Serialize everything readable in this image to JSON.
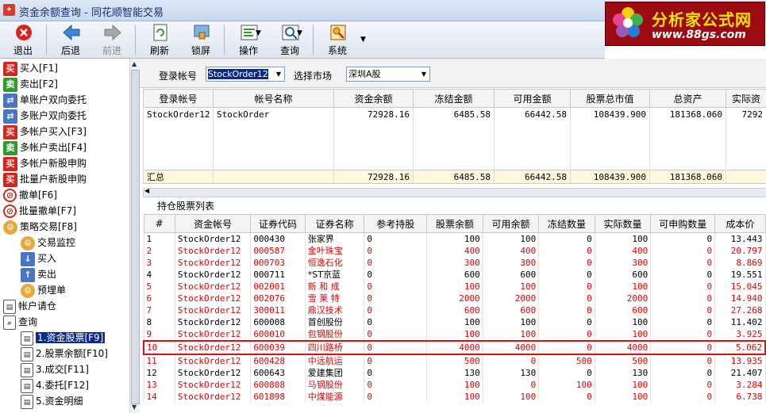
{
  "window": {
    "title": "资金余额查询 - 同花顺智能交易"
  },
  "logo": {
    "text": "分析家公式网",
    "url": "www.88gs.com"
  },
  "toolbar": {
    "exit": "退出",
    "back": "后退",
    "forward": "前进",
    "refresh": "刷新",
    "lock": "锁屏",
    "operate": "操作",
    "query": "查询",
    "system": "系统"
  },
  "sidebar": {
    "items": [
      {
        "label": "买入[F1]"
      },
      {
        "label": "卖出[F2]"
      },
      {
        "label": "单账户双向委托"
      },
      {
        "label": "多账户双向委托"
      },
      {
        "label": "多帐户买入[F3]"
      },
      {
        "label": "多帐户卖出[F4]"
      },
      {
        "label": "多帐户新股申购"
      },
      {
        "label": "批量户新股申购"
      },
      {
        "label": "撤单[F6]"
      },
      {
        "label": "批量撤单[F7]"
      },
      {
        "label": "策略交易[F8]"
      },
      {
        "label": "交易监控"
      },
      {
        "label": "买入"
      },
      {
        "label": "卖出"
      },
      {
        "label": "预埋单"
      },
      {
        "label": "帐户请仓"
      },
      {
        "label": "查询"
      },
      {
        "label": "1.资金股票[F9]"
      },
      {
        "label": "2.股票余额[F10]"
      },
      {
        "label": "3.成交[F11]"
      },
      {
        "label": "4.委托[F12]"
      },
      {
        "label": "5.资金明细"
      }
    ],
    "glyphs": {
      "buy": "买",
      "sell": "卖"
    }
  },
  "filter": {
    "account_label": "登录帐号",
    "account_value": "StockOrder12",
    "market_label": "选择市场",
    "market_value": "深圳A股"
  },
  "accounts": {
    "headers": [
      "登录帐号",
      "帐号名称",
      "资金余额",
      "冻结金额",
      "可用金额",
      "股票总市值",
      "总资产",
      "实际资"
    ],
    "row": [
      "StockOrder12",
      "StockOrder",
      "72928.16",
      "6485.58",
      "66442.58",
      "108439.900",
      "181368.060",
      "7292"
    ],
    "summary": [
      "汇总",
      "",
      "72928.16",
      "6485.58",
      "66442.58",
      "108439.900",
      "181368.060",
      ""
    ]
  },
  "positions": {
    "label": "持仓股票列表",
    "headers": [
      "#",
      "资金帐号",
      "证券代码",
      "证券名称",
      "参考持股",
      "股票余额",
      "可用余额",
      "冻结数量",
      "实际数量",
      "可申购数量",
      "成本价"
    ],
    "rows": [
      [
        "1",
        "StockOrder12",
        "000430",
        "张家界",
        "0",
        "100",
        "100",
        "0",
        "100",
        "0",
        "13.443"
      ],
      [
        "2",
        "StockOrder12",
        "000587",
        "金叶珠宝",
        "0",
        "400",
        "400",
        "0",
        "400",
        "0",
        "20.797"
      ],
      [
        "3",
        "StockOrder12",
        "000703",
        "恒逸石化",
        "0",
        "300",
        "300",
        "0",
        "300",
        "0",
        "8.869"
      ],
      [
        "4",
        "StockOrder12",
        "000711",
        "*ST京蓝",
        "0",
        "600",
        "600",
        "0",
        "600",
        "0",
        "19.551"
      ],
      [
        "5",
        "StockOrder12",
        "002001",
        "新 和 成",
        "0",
        "100",
        "100",
        "0",
        "100",
        "0",
        "15.045"
      ],
      [
        "6",
        "StockOrder12",
        "002076",
        "雪 莱 特",
        "0",
        "2000",
        "2000",
        "0",
        "2000",
        "0",
        "14.940"
      ],
      [
        "7",
        "StockOrder12",
        "300011",
        "鼎汉技术",
        "0",
        "600",
        "600",
        "0",
        "600",
        "0",
        "27.268"
      ],
      [
        "8",
        "StockOrder12",
        "600008",
        "首创股份",
        "0",
        "100",
        "100",
        "0",
        "100",
        "0",
        "11.402"
      ],
      [
        "9",
        "StockOrder12",
        "600010",
        "包钢股份",
        "0",
        "100",
        "100",
        "0",
        "100",
        "0",
        "3.925"
      ],
      [
        "10",
        "StockOrder12",
        "600039",
        "四川路桥",
        "0",
        "4000",
        "4000",
        "0",
        "4000",
        "0",
        "5.062"
      ],
      [
        "11",
        "StockOrder12",
        "600428",
        "中远航运",
        "0",
        "500",
        "0",
        "500",
        "500",
        "0",
        "13.935"
      ],
      [
        "12",
        "StockOrder12",
        "600643",
        "爱建集团",
        "0",
        "130",
        "130",
        "0",
        "130",
        "0",
        "21.407"
      ],
      [
        "13",
        "StockOrder12",
        "600808",
        "马钢股份",
        "0",
        "100",
        "0",
        "100",
        "100",
        "0",
        "3.284"
      ],
      [
        "14",
        "StockOrder12",
        "601898",
        "中煤能源",
        "0",
        "100",
        "100",
        "0",
        "100",
        "0",
        "6.738"
      ]
    ],
    "red_rows": [
      2,
      3,
      5,
      6,
      7,
      9,
      10,
      11,
      13,
      14
    ],
    "highlighted_row": 10,
    "colors": {
      "up": "#e60000",
      "down": "#000000",
      "highlight_border": "#e01010"
    }
  }
}
